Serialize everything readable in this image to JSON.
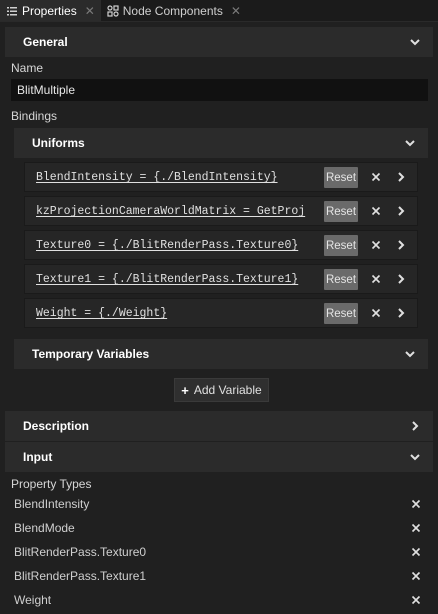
{
  "tabs": [
    {
      "label": "Properties",
      "icon": "list-icon",
      "active": true
    },
    {
      "label": "Node Components",
      "icon": "components-icon",
      "active": false
    }
  ],
  "general": {
    "title": "General",
    "name_label": "Name",
    "name_value": "BlitMultiple",
    "bindings_label": "Bindings"
  },
  "uniforms": {
    "title": "Uniforms",
    "reset_label": "Reset",
    "rows": [
      {
        "expr": "BlendIntensity = {./BlendIntensity}"
      },
      {
        "expr": "kzProjectionCameraWorldMatrix = GetProj"
      },
      {
        "expr": "Texture0 = {./BlitRenderPass.Texture0}"
      },
      {
        "expr": "Texture1 = {./BlitRenderPass.Texture1}"
      },
      {
        "expr": "Weight = {./Weight}"
      }
    ]
  },
  "temporary_variables": {
    "title": "Temporary Variables",
    "add_label": "Add Variable"
  },
  "description": {
    "title": "Description"
  },
  "input": {
    "title": "Input",
    "property_types_label": "Property Types",
    "items": [
      {
        "label": "BlendIntensity"
      },
      {
        "label": "BlendMode"
      },
      {
        "label": "BlitRenderPass.Texture0"
      },
      {
        "label": "BlitRenderPass.Texture1"
      },
      {
        "label": "Weight"
      }
    ]
  }
}
